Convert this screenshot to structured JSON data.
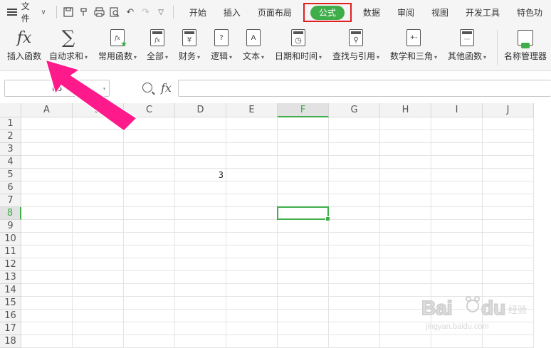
{
  "menu": {
    "file_label": "文件",
    "tabs": [
      "开始",
      "插入",
      "页面布局",
      "公式",
      "数据",
      "审阅",
      "视图",
      "开发工具",
      "特色功"
    ],
    "active_tab": "公式"
  },
  "ribbon": {
    "buttons": [
      {
        "label": "插入函数",
        "dropdown": false
      },
      {
        "label": "自动求和",
        "dropdown": true
      },
      {
        "label": "常用函数",
        "dropdown": true
      },
      {
        "label": "全部",
        "dropdown": true
      },
      {
        "label": "财务",
        "dropdown": true
      },
      {
        "label": "逻辑",
        "dropdown": true
      },
      {
        "label": "文本",
        "dropdown": true
      },
      {
        "label": "日期和时间",
        "dropdown": true
      },
      {
        "label": "查找与引用",
        "dropdown": true
      },
      {
        "label": "数学和三角",
        "dropdown": true
      },
      {
        "label": "其他函数",
        "dropdown": true
      },
      {
        "label": "名称管理器",
        "dropdown": false
      }
    ],
    "icon_texts": {
      "fx": "fx",
      "sigma": "∑",
      "finance": "¥",
      "logic": "?",
      "text": "A",
      "math": "+-",
      "other": "···"
    }
  },
  "formula_bar": {
    "name_box": "F8",
    "fx_label": "fx",
    "formula": ""
  },
  "sheet": {
    "columns": [
      "A",
      "B",
      "C",
      "D",
      "E",
      "F",
      "G",
      "H",
      "I",
      "J"
    ],
    "rows": [
      "1",
      "2",
      "3",
      "4",
      "5",
      "6",
      "7",
      "8",
      "9",
      "10",
      "11",
      "12",
      "13",
      "14",
      "15",
      "16",
      "17",
      "18"
    ],
    "selected_column": "F",
    "selected_row": "8",
    "cells": [
      {
        "col": "D",
        "row": "5",
        "value": "3"
      }
    ]
  },
  "accent_colors": {
    "active_tab": "#3fae4a",
    "highlight_box": "#e02020",
    "arrow": "#ff1a8c"
  },
  "watermark": {
    "brand": "Bai du 经验",
    "url": "jingyan.baidu.com"
  }
}
